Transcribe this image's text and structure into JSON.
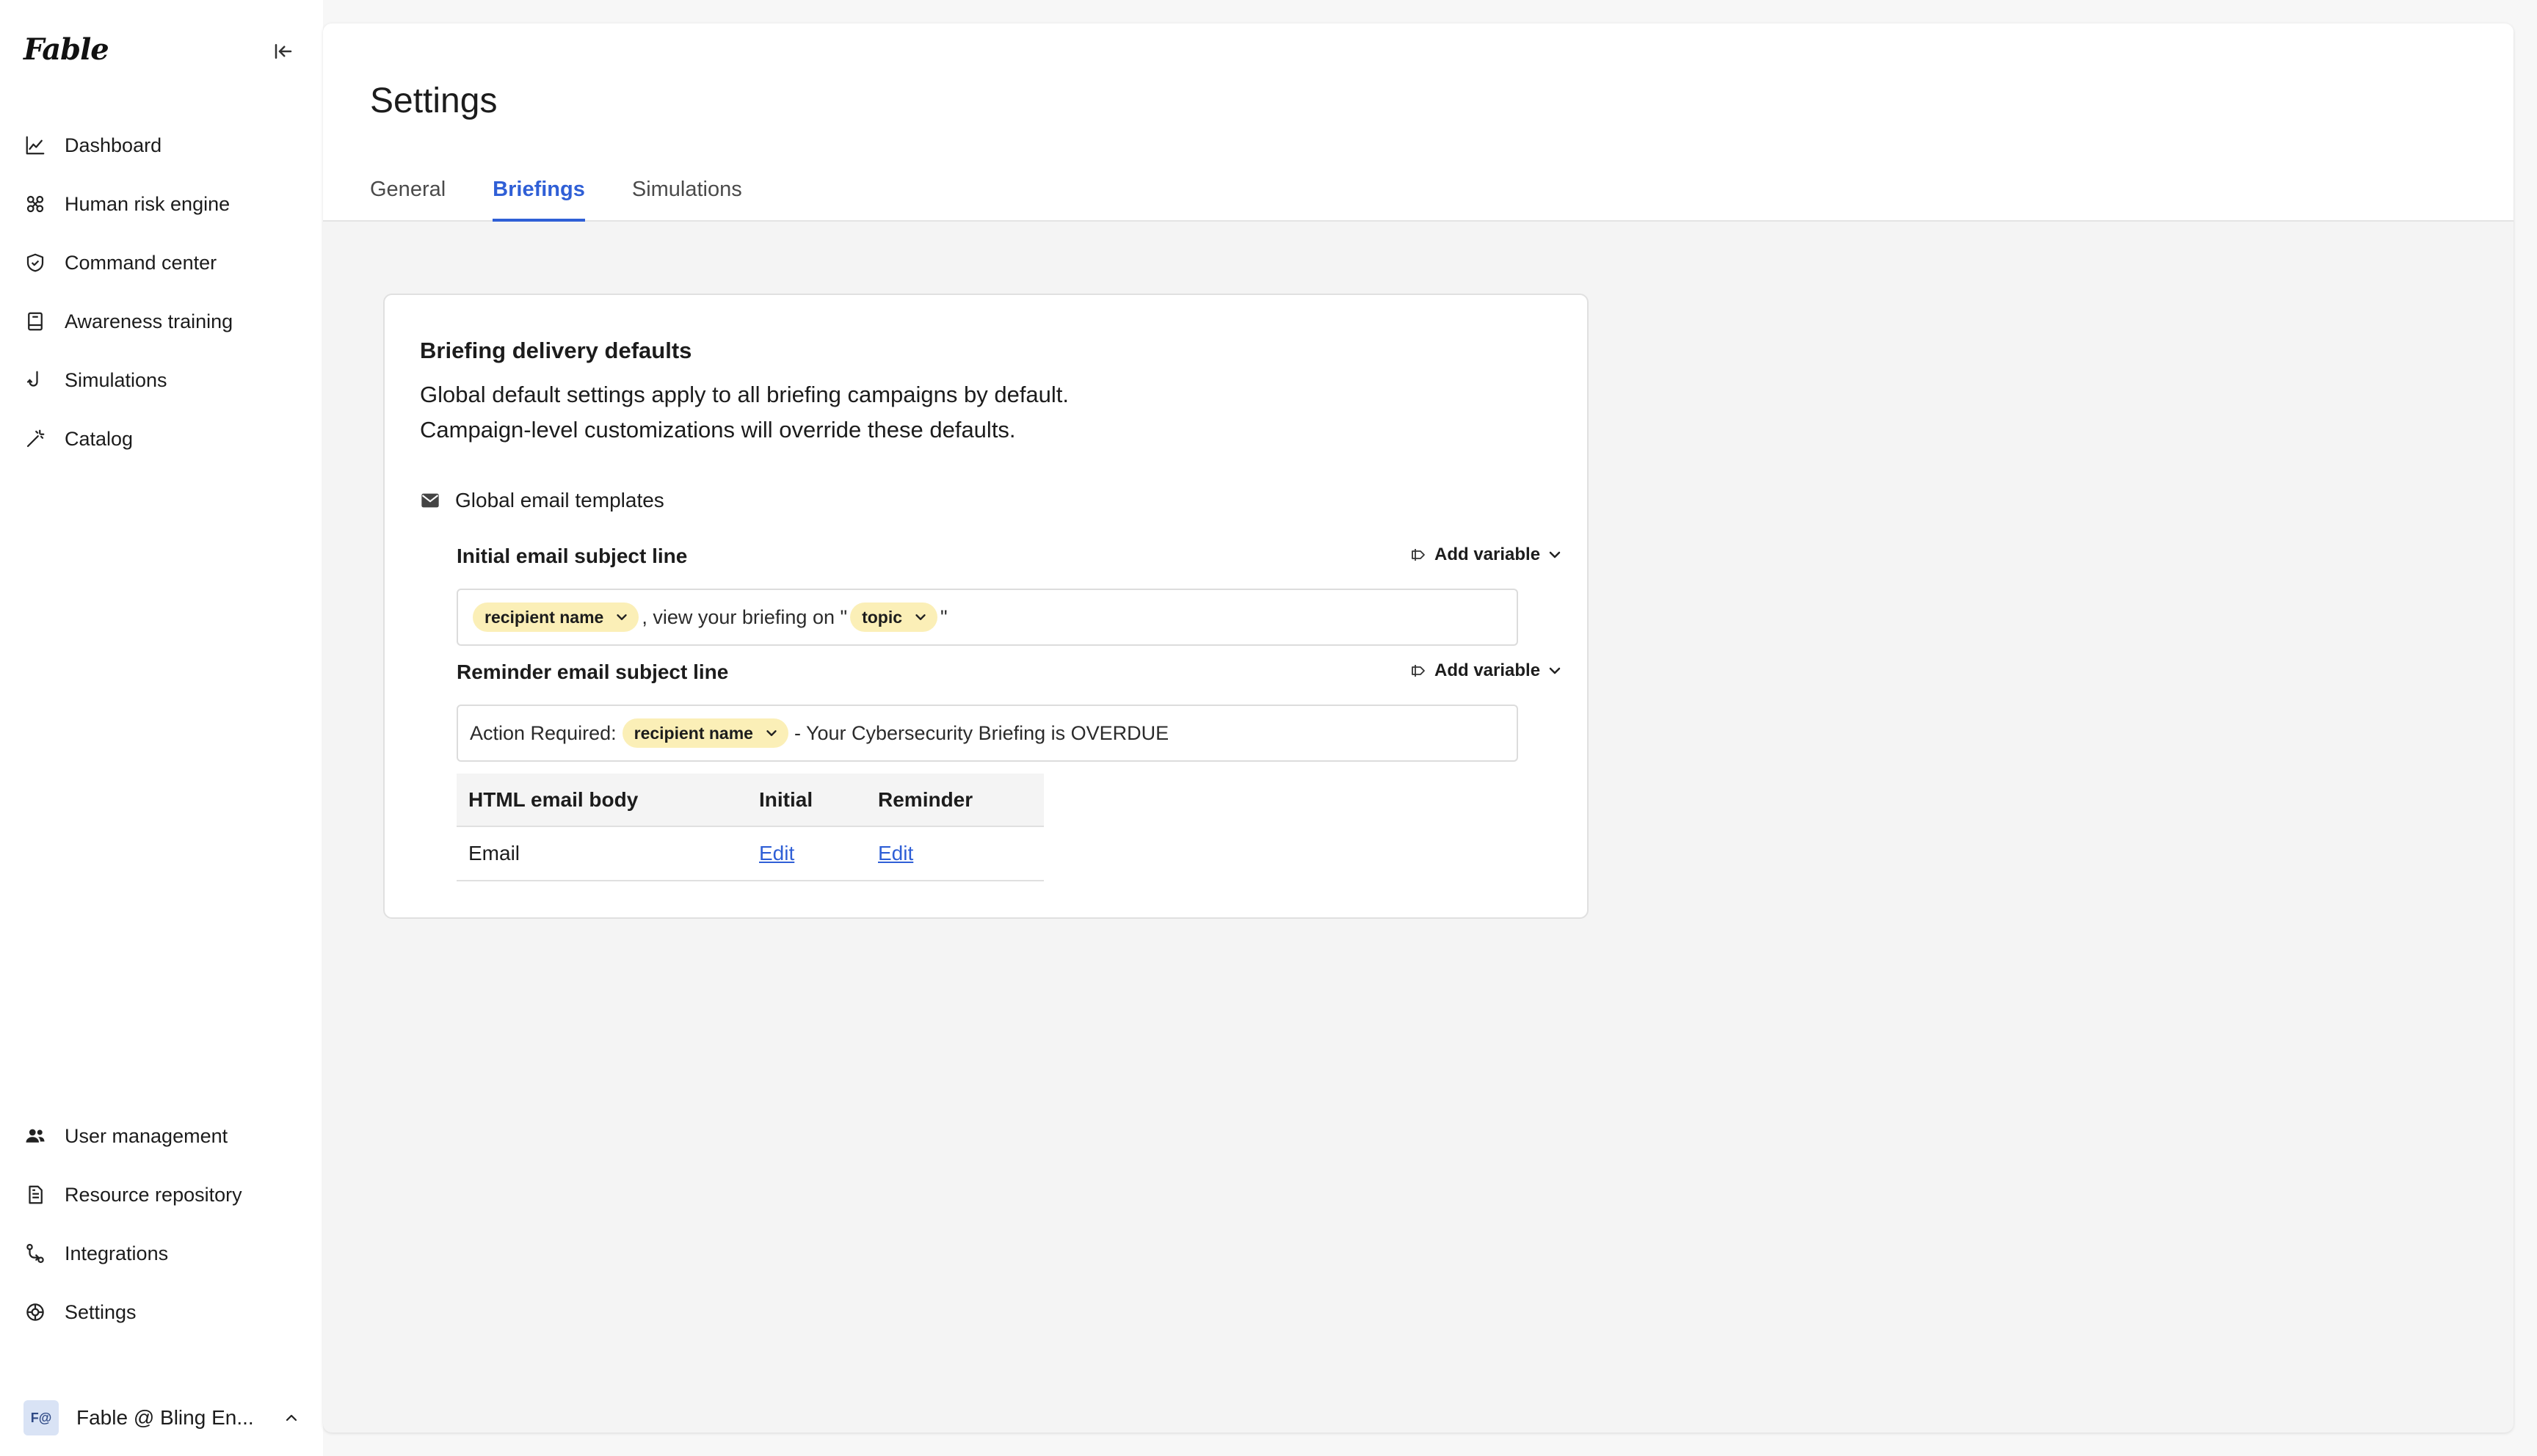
{
  "app": {
    "logo": "Fable"
  },
  "sidebar": {
    "items": [
      {
        "label": "Dashboard",
        "icon": "chart-line-icon"
      },
      {
        "label": "Human risk engine",
        "icon": "molecule-icon"
      },
      {
        "label": "Command center",
        "icon": "shield-check-icon"
      },
      {
        "label": "Awareness training",
        "icon": "book-icon"
      },
      {
        "label": "Simulations",
        "icon": "fishhook-icon"
      },
      {
        "label": "Catalog",
        "icon": "magic-wand-icon"
      }
    ],
    "bottom_items": [
      {
        "label": "User management",
        "icon": "users-icon"
      },
      {
        "label": "Resource repository",
        "icon": "document-list-icon"
      },
      {
        "label": "Integrations",
        "icon": "git-merge-icon"
      },
      {
        "label": "Settings",
        "icon": "gear-icon"
      }
    ],
    "account": {
      "initials": "F@",
      "name": "Fable @ Bling En..."
    }
  },
  "page": {
    "title": "Settings",
    "tabs": [
      {
        "label": "General",
        "active": false
      },
      {
        "label": "Briefings",
        "active": true
      },
      {
        "label": "Simulations",
        "active": false
      }
    ]
  },
  "card": {
    "title": "Briefing delivery defaults",
    "desc_line1": "Global default settings apply to all briefing campaigns by default.",
    "desc_line2": "Campaign-level customizations will override these defaults.",
    "section_title": "Global email templates",
    "initial": {
      "label": "Initial email subject line",
      "add_variable": "Add variable",
      "chip1": "recipient name",
      "text1": ", view your briefing on \"",
      "chip2": "topic",
      "text2": "\""
    },
    "reminder": {
      "label": "Reminder email subject line",
      "add_variable": "Add variable",
      "text1": "Action Required:",
      "chip1": "recipient name",
      "text2": "- Your Cybersecurity Briefing is OVERDUE"
    },
    "table": {
      "headers": [
        "HTML email body",
        "Initial",
        "Reminder"
      ],
      "rows": [
        {
          "name": "Email",
          "initial": "Edit",
          "reminder": "Edit"
        }
      ]
    }
  },
  "colors": {
    "accent": "#2f5fd6",
    "chip_bg": "#fbefb7",
    "panel_bg": "#f4f4f4"
  }
}
